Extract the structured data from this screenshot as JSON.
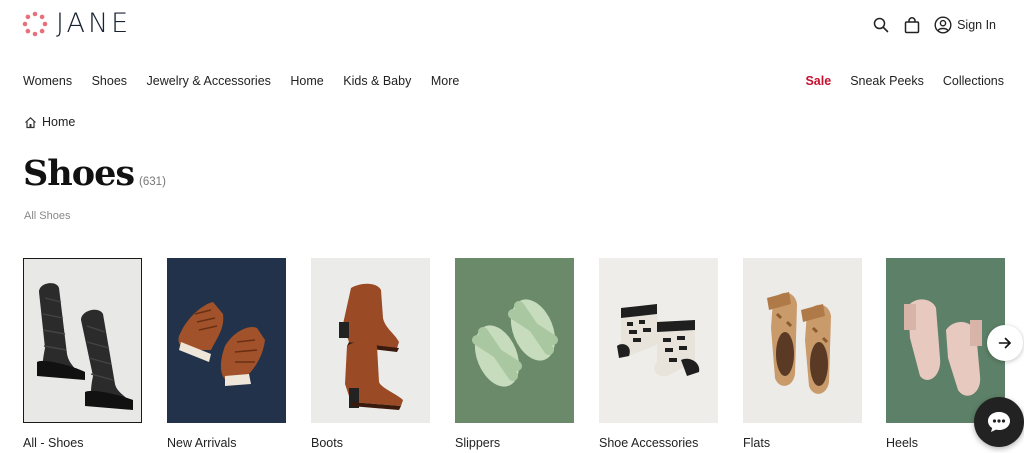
{
  "brand": {
    "name": "JANE",
    "accent": "#e8707a"
  },
  "header": {
    "signin_label": "Sign In",
    "icons": [
      "search-icon",
      "shopping-bag-icon",
      "user-icon"
    ]
  },
  "nav": {
    "left": [
      "Womens",
      "Shoes",
      "Jewelry & Accessories",
      "Home",
      "Kids & Baby",
      "More"
    ],
    "right": [
      "Sale",
      "Sneak Peeks",
      "Collections"
    ],
    "sale_color": "#c8102e"
  },
  "breadcrumb": {
    "home_label": "Home"
  },
  "page": {
    "title": "Shoes",
    "count": "(631)",
    "subcategory": "All Shoes"
  },
  "categories": [
    {
      "label": "All - Shoes",
      "selected": true,
      "bg": "#e8e8e6"
    },
    {
      "label": "New Arrivals",
      "selected": false,
      "bg": "#22324a"
    },
    {
      "label": "Boots",
      "selected": false,
      "bg": "#ebebe9"
    },
    {
      "label": "Slippers",
      "selected": false,
      "bg": "#6b8a6a"
    },
    {
      "label": "Shoe Accessories",
      "selected": false,
      "bg": "#efedea"
    },
    {
      "label": "Flats",
      "selected": false,
      "bg": "#ecebe8"
    },
    {
      "label": "Heels",
      "selected": false,
      "bg": "#5d8068"
    }
  ]
}
